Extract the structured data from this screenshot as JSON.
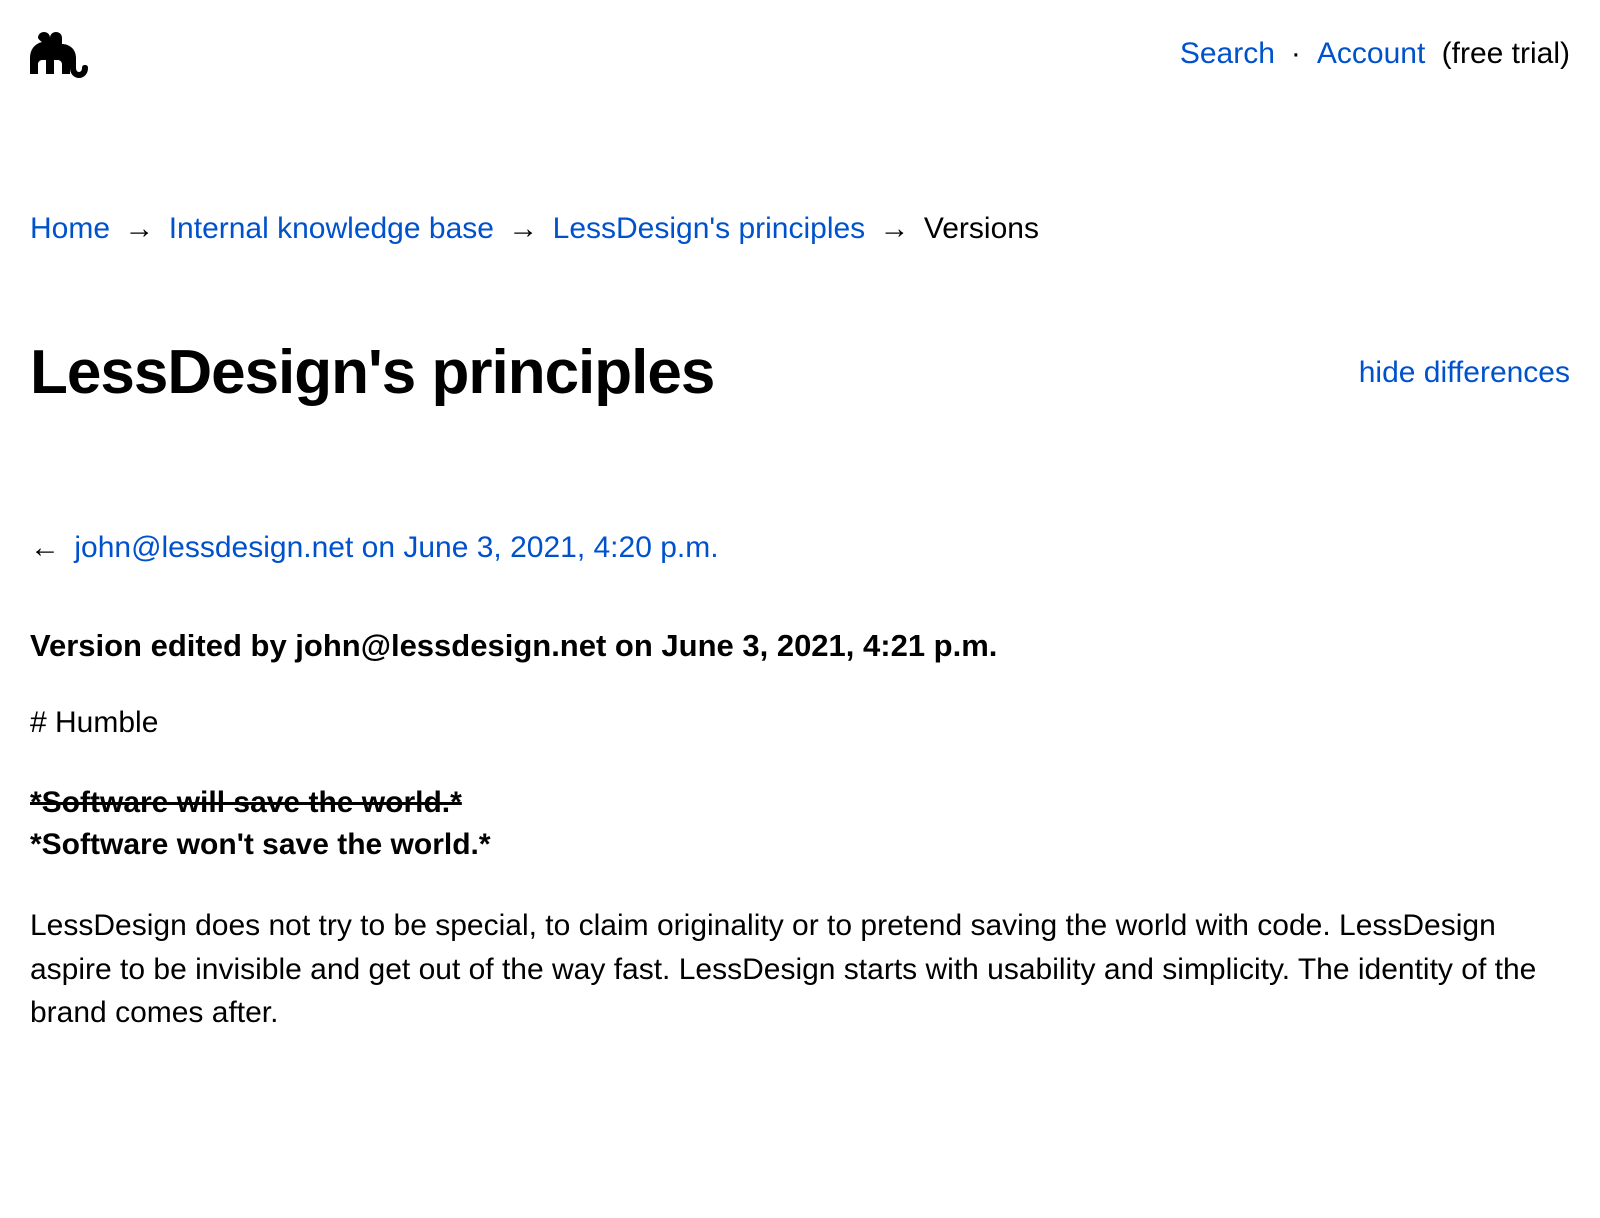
{
  "header": {
    "search_label": "Search",
    "account_label": "Account",
    "free_trial_label": "(free trial)"
  },
  "breadcrumb": {
    "home": "Home",
    "kb": "Internal knowledge base",
    "principles": "LessDesign's principles",
    "current": "Versions",
    "arrow": "→"
  },
  "title": "LessDesign's principles",
  "hide_differences": "hide differences",
  "prev_version": {
    "arrow": "←",
    "label": "john@lessdesign.net on June 3, 2021, 4:20 p.m."
  },
  "version_editor": "Version edited by john@lessdesign.net on June 3, 2021, 4:21 p.m.",
  "content": {
    "heading_line": "# Humble",
    "diff_removed": "*Software will save the world.*",
    "diff_added": "*Software won't save the world.*",
    "paragraph": "LessDesign does not try to be special, to claim originality or to pretend saving the world with code. LessDesign aspire to be invisible and get out of the way fast. LessDesign starts with usability and simplicity. The identity of the brand comes after."
  }
}
